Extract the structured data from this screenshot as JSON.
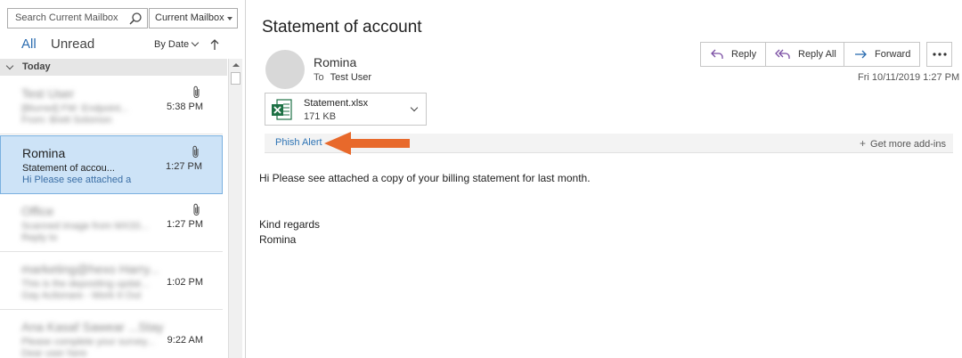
{
  "search": {
    "placeholder": "Search Current Mailbox",
    "scope": "Current Mailbox"
  },
  "filters": {
    "all": "All",
    "unread": "Unread",
    "sort": "By Date"
  },
  "group": {
    "label": "Today"
  },
  "messages": [
    {
      "sender": "Test User",
      "subject": "[Blurred] FW: Endpoint...",
      "preview": "From: Brett Solomon",
      "time": "5:38 PM",
      "attachment": true,
      "selected": false,
      "blurred": true
    },
    {
      "sender": "Romina",
      "subject": "Statement of accou...",
      "preview": "Hi Please see attached a",
      "time": "1:27 PM",
      "attachment": true,
      "selected": true,
      "blurred": false
    },
    {
      "sender": "Office",
      "subject": "Scanned image from MX33...",
      "preview": "Reply to",
      "time": "1:27 PM",
      "attachment": true,
      "selected": false,
      "blurred": true
    },
    {
      "sender": "marketing@hexo Harry...",
      "subject": "This is the depositing updat...",
      "preview": "Gay Actionare - Work It Out",
      "time": "1:02 PM",
      "attachment": false,
      "selected": false,
      "blurred": true
    },
    {
      "sender": "Ana Kasaf Sawear ...Stay",
      "subject": "Please complete your survey...",
      "preview": "Dear user here",
      "time": "9:22 AM",
      "attachment": false,
      "selected": false,
      "blurred": true
    }
  ],
  "email": {
    "subject": "Statement of account",
    "from": "Romina",
    "to_label": "To",
    "to": "Test User",
    "datetime": "Fri 10/11/2019 1:27 PM",
    "attachment": {
      "name": "Statement.xlsx",
      "size": "171 KB"
    },
    "body": [
      "Hi Please see attached a copy of your billing statement for last month.",
      "Kind regards",
      "Romina"
    ]
  },
  "actions": {
    "reply": "Reply",
    "reply_all": "Reply All",
    "forward": "Forward"
  },
  "addins": {
    "phish_alert": "Phish Alert",
    "get_more": "Get more add-ins"
  },
  "colors": {
    "accent": "#2e74b5",
    "selection": "#cde3f7",
    "arrow": "#e8692b",
    "excel": "#1e7145"
  }
}
